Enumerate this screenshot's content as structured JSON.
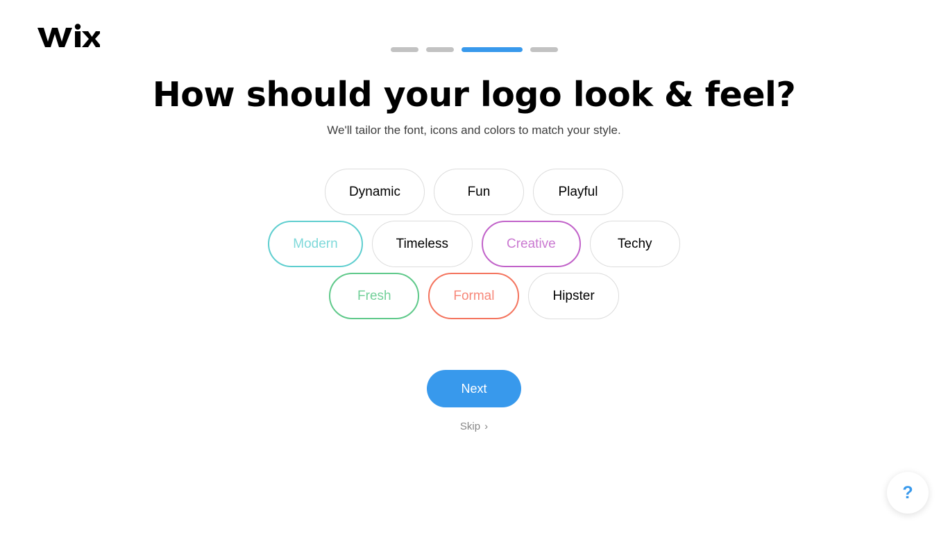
{
  "brand": {
    "logo_text": "WiX",
    "accent_blue": "#3899ec"
  },
  "progress": {
    "steps": [
      {
        "state": "inactive",
        "color": "#c2c2c2"
      },
      {
        "state": "inactive",
        "color": "#c2c2c2"
      },
      {
        "state": "active",
        "color": "#3899ec"
      },
      {
        "state": "inactive",
        "color": "#c2c2c2"
      }
    ],
    "current_step": 3,
    "total_steps": 4
  },
  "header": {
    "title": "How should your logo look & feel?",
    "subtitle": "We'll tailor the font, icons and colors to match your style."
  },
  "chips": {
    "rows": [
      [
        {
          "label": "Dynamic",
          "selected": false,
          "color": "#dcdcdc",
          "text_color": "#000000"
        },
        {
          "label": "Fun",
          "selected": false,
          "color": "#dcdcdc",
          "text_color": "#000000"
        },
        {
          "label": "Playful",
          "selected": false,
          "color": "#dcdcdc",
          "text_color": "#000000"
        }
      ],
      [
        {
          "label": "Modern",
          "selected": true,
          "color": "#5ececf",
          "text_color": "#7fd9da"
        },
        {
          "label": "Timeless",
          "selected": false,
          "color": "#dcdcdc",
          "text_color": "#000000"
        },
        {
          "label": "Creative",
          "selected": true,
          "color": "#c162c9",
          "text_color": "#ca79d1"
        },
        {
          "label": "Techy",
          "selected": false,
          "color": "#dcdcdc",
          "text_color": "#000000"
        }
      ],
      [
        {
          "label": "Fresh",
          "selected": true,
          "color": "#5fc98a",
          "text_color": "#72d099"
        },
        {
          "label": "Formal",
          "selected": true,
          "color": "#f4745e",
          "text_color": "#f7887a"
        },
        {
          "label": "Hipster",
          "selected": false,
          "color": "#dcdcdc",
          "text_color": "#000000"
        }
      ]
    ]
  },
  "actions": {
    "next_label": "Next",
    "skip_label": "Skip",
    "skip_chevron": "›"
  },
  "help": {
    "icon_label": "?"
  }
}
